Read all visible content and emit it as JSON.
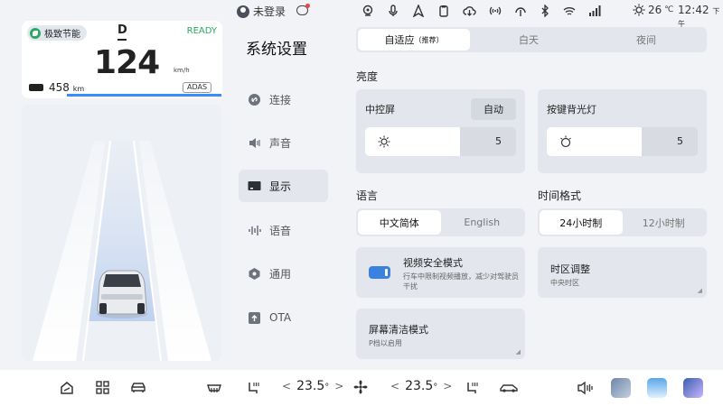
{
  "status": {
    "user_label": "未登录",
    "temperature": "26",
    "temp_unit": "℃",
    "time": "12:42",
    "time_period": "下午"
  },
  "drive": {
    "eco_mode": "极致节能",
    "gear": "D",
    "ready": "READY",
    "speed": "124",
    "speed_unit": "km/h",
    "range": "458",
    "range_unit": "km",
    "adas": "ADAS"
  },
  "nav": {
    "title": "系统设置",
    "items": [
      {
        "label": "连接",
        "icon": "link-icon"
      },
      {
        "label": "声音",
        "icon": "speaker-icon"
      },
      {
        "label": "显示",
        "icon": "display-icon"
      },
      {
        "label": "语音",
        "icon": "voice-icon"
      },
      {
        "label": "通用",
        "icon": "hexagon-icon"
      },
      {
        "label": "OTA",
        "icon": "upload-icon"
      }
    ],
    "active_index": 2
  },
  "display": {
    "theme_options": {
      "adaptive": "自适应",
      "recommended": "（推荐）",
      "day": "白天",
      "night": "夜间"
    },
    "brightness_label": "亮度",
    "center_screen": {
      "title": "中控屏",
      "auto_label": "自动",
      "value": "5",
      "level": 0.5
    },
    "key_backlight": {
      "title": "按键背光灯",
      "value": "5",
      "level": 0.5
    },
    "language_label": "语言",
    "language_options": [
      "中文简体",
      "English"
    ],
    "time_format_label": "时间格式",
    "time_format_options": [
      "24小时制",
      "12小时制"
    ],
    "video_safety": {
      "title": "视频安全模式",
      "desc": "行车中限制视频播放，减少对驾驶员干扰",
      "enabled": true
    },
    "timezone": {
      "title": "时区调整",
      "value": "中央时区"
    },
    "screen_clean": {
      "title": "屏幕清洁模式",
      "desc": "P档以启用"
    }
  },
  "dock": {
    "left_temp": "23.5",
    "right_temp": "23.5",
    "temp_unit": "°"
  },
  "colors": {
    "accent": "#3b8bff",
    "ready_green": "#2aa864",
    "toggle_blue": "#3b82e0"
  }
}
